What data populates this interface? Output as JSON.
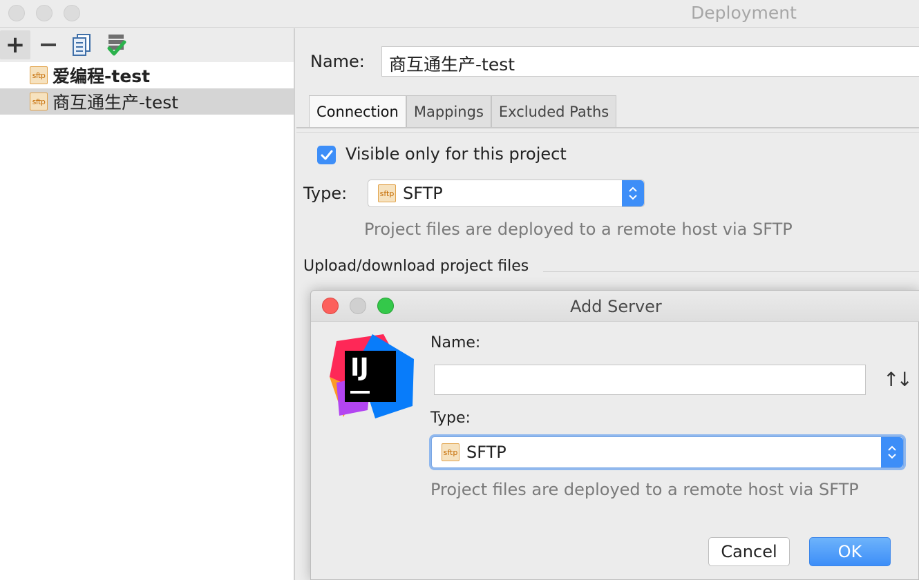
{
  "window": {
    "title": "Deployment"
  },
  "toolbar": {
    "add_label": "+"
  },
  "servers": [
    {
      "label": "爱编程-test",
      "icon": "sftp",
      "bold": true
    },
    {
      "label": "商互通生产-test",
      "icon": "sftp",
      "selected": true
    }
  ],
  "detail": {
    "name_label": "Name:",
    "name_value": "商互通生产-test",
    "tabs": [
      {
        "label": "Connection",
        "active": true
      },
      {
        "label": "Mappings"
      },
      {
        "label": "Excluded Paths"
      }
    ],
    "visible_label": "Visible only for this project",
    "visible_checked": true,
    "type_label": "Type:",
    "type_value": "SFTP",
    "type_desc": "Project files are deployed to a remote host via SFTP",
    "upload_label": "Upload/download project files"
  },
  "dialog": {
    "title": "Add Server",
    "logo_text": "IJ",
    "name_label": "Name:",
    "name_value": "",
    "type_label": "Type:",
    "type_value": "SFTP",
    "type_desc": "Project files are deployed to a remote host via SFTP",
    "cancel_label": "Cancel",
    "ok_label": "OK"
  },
  "icons": {
    "sftp_text": "sftp"
  },
  "colors": {
    "accent": "#3d8ef8",
    "close": "#fc605c",
    "minimize": "#d0d0d0",
    "zoom": "#34c84a"
  }
}
